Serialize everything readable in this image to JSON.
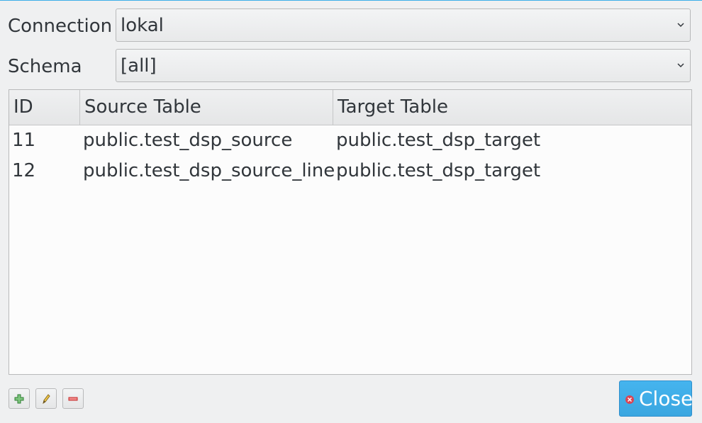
{
  "form": {
    "connection_label": "Connection",
    "connection_value": "lokal",
    "schema_label": "Schema",
    "schema_value": "[all]"
  },
  "table": {
    "headers": [
      "ID",
      "Source Table",
      "Target Table"
    ],
    "rows": [
      {
        "id": "11",
        "source": "public.test_dsp_source",
        "target": "public.test_dsp_target"
      },
      {
        "id": "12",
        "source": "public.test_dsp_source_line",
        "target": "public.test_dsp_target"
      }
    ]
  },
  "toolbar": {
    "add_icon": "plus-icon",
    "edit_icon": "pencil-icon",
    "remove_icon": "minus-icon",
    "close_label": "Close",
    "close_icon": "close-circle-icon"
  },
  "colors": {
    "accent": "#3daee9",
    "window_bg": "#eff0f1",
    "text": "#31363b",
    "add_green": "#3b9a3b",
    "remove_red": "#da4453"
  }
}
